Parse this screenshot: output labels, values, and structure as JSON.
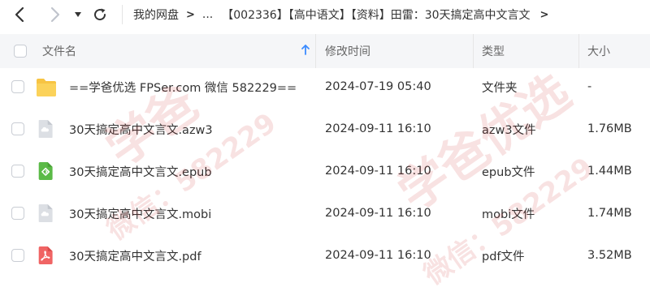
{
  "navigation": {
    "back_icon": "chevron-left-icon",
    "forward_icon": "chevron-right-icon",
    "dropdown_icon": "caret-down-icon",
    "refresh_icon": "refresh-icon"
  },
  "breadcrumb": {
    "root": "我的网盘",
    "separator": ">",
    "ellipsis": "...",
    "current": "【002336】【高中语文】【资料】田雷：30天搞定高中文言文",
    "trailing_arrow": ">"
  },
  "table": {
    "columns": {
      "name": "文件名",
      "modified": "修改时间",
      "type": "类型",
      "size": "大小"
    },
    "sort_icon": "sort-up-arrow-icon",
    "rows": [
      {
        "name": "==学爸优选 FPSer.com 微信 582229==",
        "modified": "2024-07-19 05:40",
        "type": "文件夹",
        "size": "-",
        "icon": "folder-icon"
      },
      {
        "name": "30天搞定高中文言文.azw3",
        "modified": "2024-09-11 16:10",
        "type": "azw3文件",
        "size": "1.76MB",
        "icon": "cloud-file-icon"
      },
      {
        "name": "30天搞定高中文言文.epub",
        "modified": "2024-09-11 16:10",
        "type": "epub文件",
        "size": "1.44MB",
        "icon": "epub-file-icon"
      },
      {
        "name": "30天搞定高中文言文.mobi",
        "modified": "2024-09-11 16:10",
        "type": "mobi文件",
        "size": "1.74MB",
        "icon": "cloud-file-icon"
      },
      {
        "name": "30天搞定高中文言文.pdf",
        "modified": "2024-09-11 16:10",
        "type": "pdf文件",
        "size": "3.52MB",
        "icon": "pdf-file-icon"
      }
    ]
  },
  "watermarks": {
    "left_main": "学爸",
    "left_sub": "微信：582229",
    "right_main": "学爸优选",
    "right_sub": "微信：582229"
  },
  "colors": {
    "folder": "#f7c443",
    "epub": "#5bba47",
    "pdf": "#f06464",
    "generic_file": "#d8dbe0",
    "header_bg": "#f5f6f8",
    "sort_arrow": "#3c8cff"
  }
}
